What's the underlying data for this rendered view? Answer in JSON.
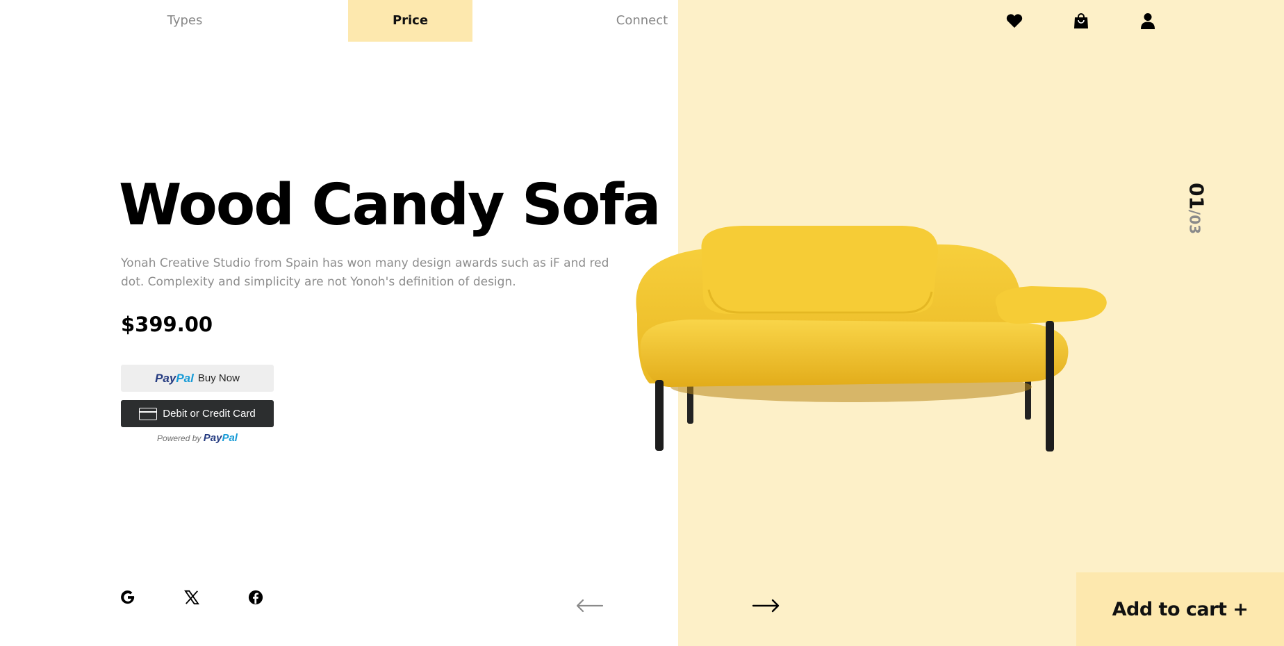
{
  "nav": {
    "items": [
      {
        "label": "Types"
      },
      {
        "label": "Price",
        "active": true
      },
      {
        "label": "Connect"
      }
    ]
  },
  "header_icons": [
    "heart-icon",
    "shopping-bag-icon",
    "user-icon"
  ],
  "product": {
    "title": "Wood Candy Sofa",
    "description": "Yonah Creative Studio from Spain has won many design awards such as iF and red dot. Complexity and simplicity are not Yonoh's definition of design.",
    "price": "$399.00"
  },
  "paypal": {
    "logo_part1": "Pay",
    "logo_part2": "Pal",
    "buy_now_label": "Buy Now",
    "card_label": "Debit or Credit Card",
    "powered_by": "Powered by"
  },
  "counter": {
    "current": "01",
    "total": "/03"
  },
  "social_icons": [
    "google-icon",
    "x-icon",
    "facebook-icon"
  ],
  "cart": {
    "label": "Add to cart +"
  },
  "colors": {
    "panel": "#fdf0c8",
    "accent": "#fde8ae",
    "sofa": "#f5c930"
  }
}
